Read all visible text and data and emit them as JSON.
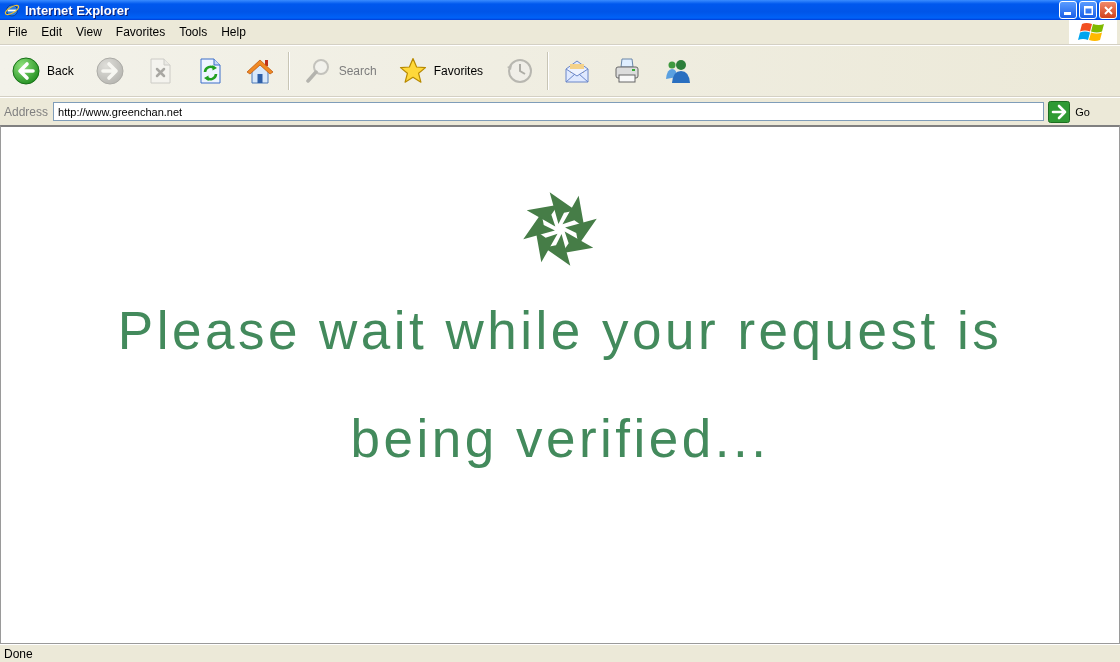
{
  "window": {
    "title": "Internet Explorer"
  },
  "menu_bar": {
    "items": [
      "File",
      "Edit",
      "View",
      "Favorites",
      "Tools",
      "Help"
    ]
  },
  "toolbar": {
    "groups": [
      [
        {
          "kind": "back",
          "label": "Back",
          "disabled": false
        },
        {
          "kind": "forward",
          "disabled": true
        },
        {
          "kind": "stop",
          "disabled": true
        },
        {
          "kind": "refresh",
          "disabled": false
        },
        {
          "kind": "home",
          "disabled": false
        }
      ],
      [
        {
          "kind": "search",
          "label": "Search",
          "disabled": true
        },
        {
          "kind": "favorites",
          "label": "Favorites",
          "disabled": false
        },
        {
          "kind": "history",
          "disabled": true
        }
      ],
      [
        {
          "kind": "mail",
          "disabled": false
        },
        {
          "kind": "print",
          "disabled": false
        },
        {
          "kind": "messenger",
          "disabled": false
        }
      ]
    ]
  },
  "address_bar": {
    "label": "Address",
    "value": "http://www.greenchan.net",
    "go_label": "Go"
  },
  "page": {
    "message": "Please wait while your request is being verified..."
  },
  "status_bar": {
    "text": "Done"
  }
}
